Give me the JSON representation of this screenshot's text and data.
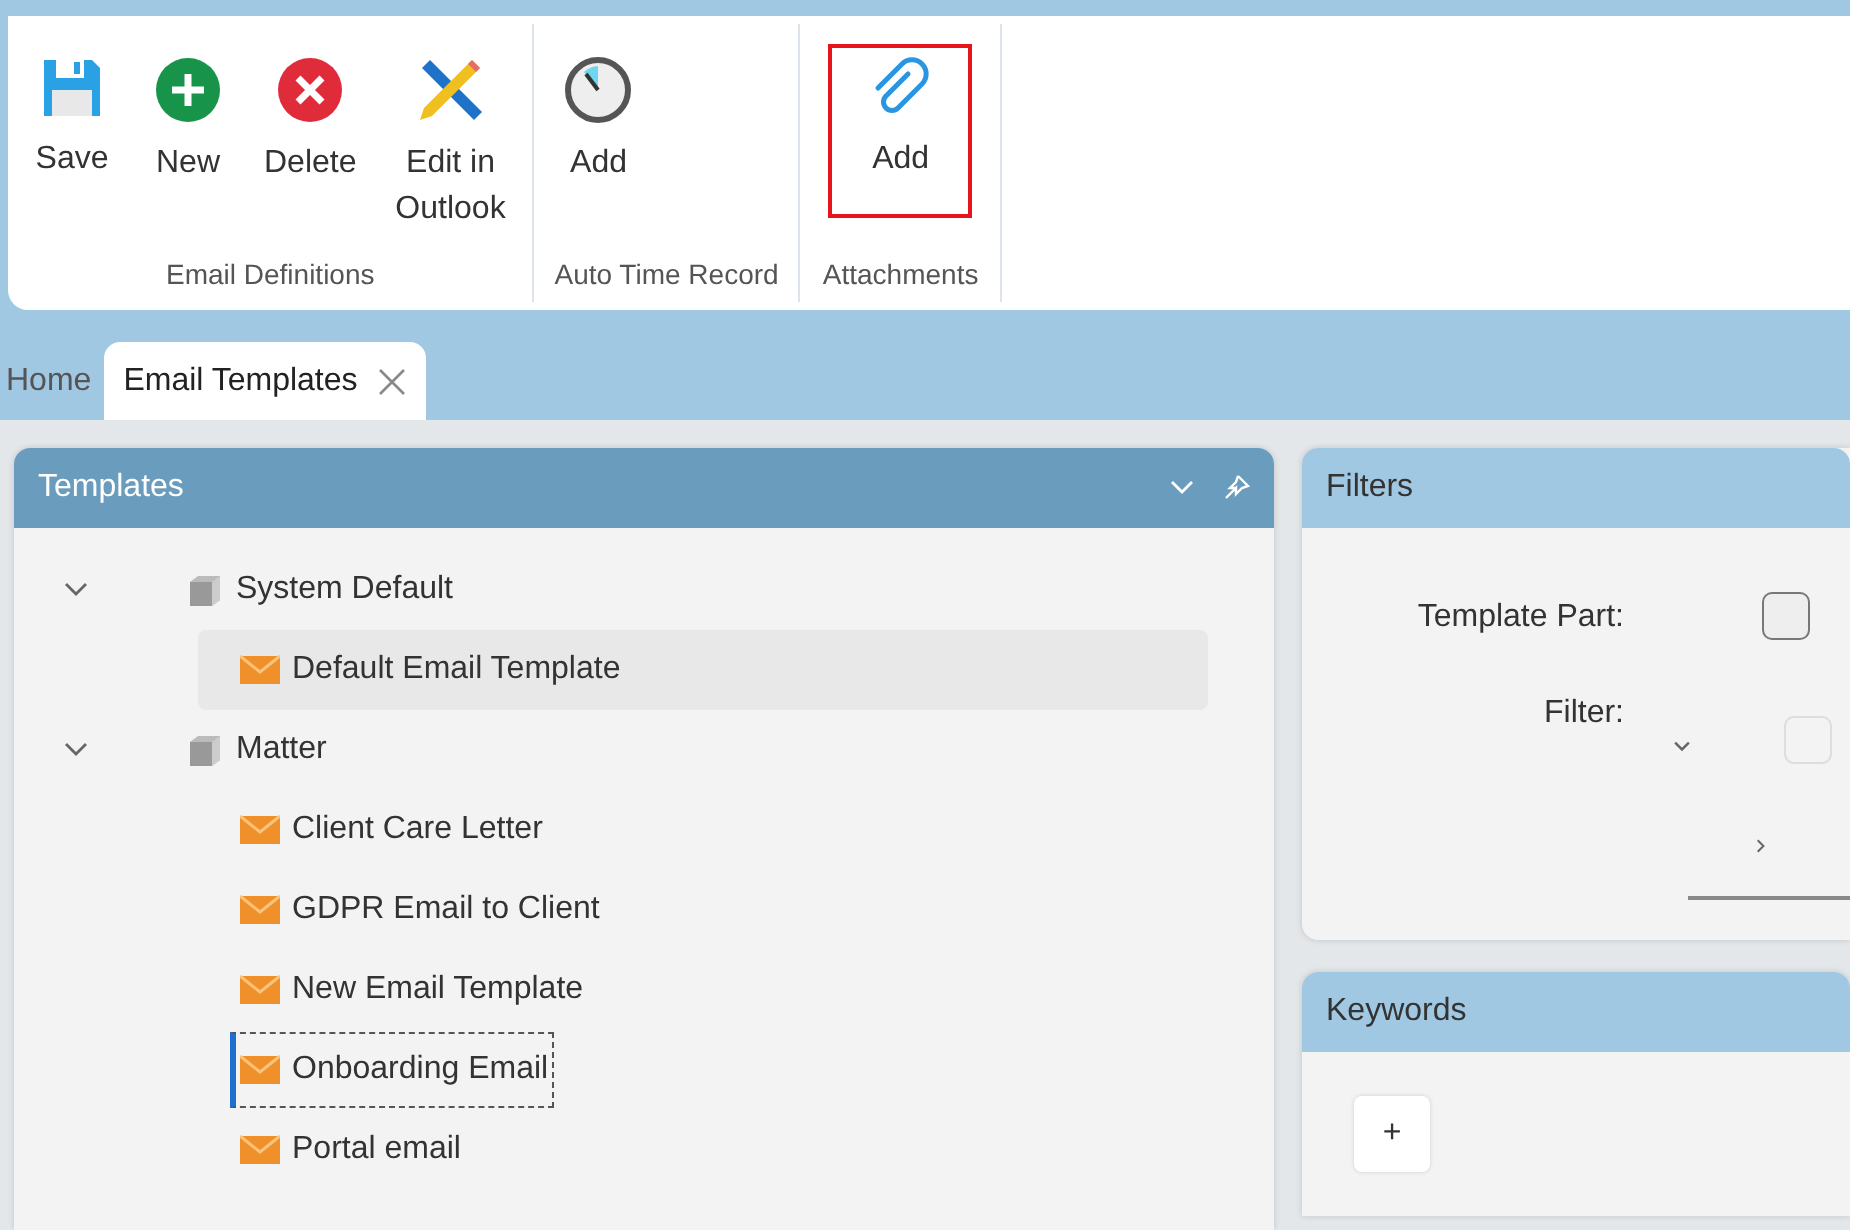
{
  "ribbon": {
    "groups": [
      {
        "label": "Email Definitions",
        "buttons": [
          {
            "kind": "save",
            "label": "Save",
            "highlighted": false
          },
          {
            "kind": "new",
            "label": "New",
            "highlighted": false
          },
          {
            "kind": "delete",
            "label": "Delete",
            "highlighted": false
          },
          {
            "kind": "edit",
            "label": "Edit in Outlook",
            "highlighted": false
          }
        ]
      },
      {
        "label": "Auto Time Record",
        "buttons": [
          {
            "kind": "clock",
            "label": "Add",
            "highlighted": false
          }
        ]
      },
      {
        "label": "Attachments",
        "buttons": [
          {
            "kind": "attach",
            "label": "Add",
            "highlighted": true
          }
        ]
      }
    ]
  },
  "tabs": [
    {
      "label": "Home",
      "selected": false,
      "closable": false
    },
    {
      "label": "Email Templates",
      "selected": true,
      "closable": true
    }
  ],
  "templates": {
    "title": "Templates",
    "tree": [
      {
        "kind": "folder",
        "label": "System Default",
        "expanded": true,
        "children": [
          {
            "kind": "email",
            "label": "Default Email Template",
            "selected": true,
            "focused": false
          }
        ]
      },
      {
        "kind": "folder",
        "label": "Matter",
        "expanded": true,
        "children": [
          {
            "kind": "email",
            "label": "Client Care Letter",
            "selected": false,
            "focused": false
          },
          {
            "kind": "email",
            "label": "GDPR Email to Client",
            "selected": false,
            "focused": false
          },
          {
            "kind": "email",
            "label": "New Email Template",
            "selected": false,
            "focused": false
          },
          {
            "kind": "email",
            "label": "Onboarding Email",
            "selected": false,
            "focused": true
          },
          {
            "kind": "email",
            "label": "Portal email",
            "selected": false,
            "focused": false
          }
        ]
      }
    ]
  },
  "filters": {
    "title": "Filters",
    "fields": [
      {
        "kind": "checkbox",
        "label": "Template Part:",
        "checked": false
      },
      {
        "kind": "dropdown",
        "label": "Filter:",
        "checked": false
      }
    ]
  },
  "keywords": {
    "title": "Keywords",
    "add_button": "+"
  }
}
